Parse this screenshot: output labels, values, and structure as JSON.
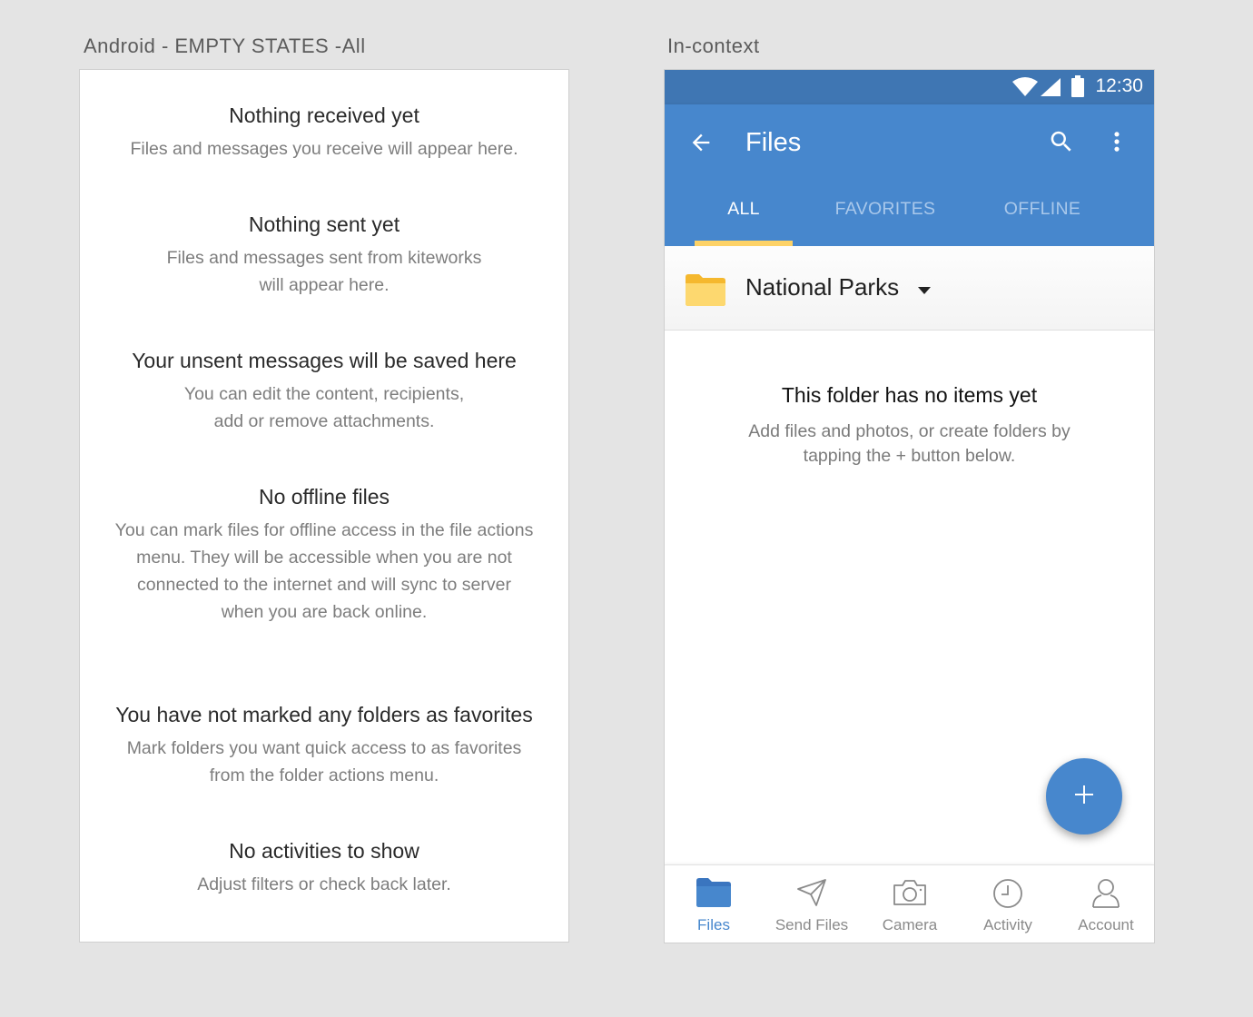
{
  "artboards": {
    "left_title": "Android - EMPTY STATES -All",
    "right_title": "In-context"
  },
  "empty_states": [
    {
      "title": "Nothing received yet",
      "lines": [
        "Files and messages you receive will appear here."
      ]
    },
    {
      "title": "Nothing sent yet",
      "lines": [
        "Files and messages sent from kiteworks",
        "will appear here."
      ]
    },
    {
      "title": "Your unsent messages will be saved here",
      "lines": [
        "You can edit the content, recipients,",
        "add or remove attachments."
      ]
    },
    {
      "title": "No offline files",
      "lines": [
        "You can mark files for offline access in the file actions",
        "menu. They will be accessible when you are not",
        "connected to the internet and will sync to server",
        "when you are back online."
      ]
    },
    {
      "title": "You have not marked any folders as favorites",
      "lines": [
        "Mark folders you want quick access to as favorites",
        "from the folder actions menu."
      ]
    },
    {
      "title": "No activities to show",
      "lines": [
        "Adjust filters or check back later."
      ]
    }
  ],
  "phone": {
    "status_bar": {
      "time": "12:30",
      "icons": [
        "wifi-icon",
        "signal-icon",
        "battery-icon"
      ]
    },
    "toolbar": {
      "title": "Files",
      "back_icon": "arrow-left-icon",
      "search_icon": "search-icon",
      "more_icon": "more-vert-icon"
    },
    "tabs": [
      {
        "label": "ALL",
        "active": true
      },
      {
        "label": "FAVORITES",
        "active": false
      },
      {
        "label": "OFFLINE",
        "active": false
      }
    ],
    "folder": {
      "name": "National Parks",
      "icon": "folder-icon",
      "dropdown_icon": "caret-down-icon"
    },
    "empty": {
      "title": "This folder has no items yet",
      "line1": "Add files and photos, or create folders by",
      "line2": "tapping the + button below."
    },
    "fab": {
      "icon": "plus-icon"
    },
    "bottom_nav": [
      {
        "label": "Files",
        "icon": "folder-icon",
        "active": true
      },
      {
        "label": "Send Files",
        "icon": "paper-plane-icon",
        "active": false
      },
      {
        "label": "Camera",
        "icon": "camera-icon",
        "active": false
      },
      {
        "label": "Activity",
        "icon": "clock-icon",
        "active": false
      },
      {
        "label": "Account",
        "icon": "person-icon",
        "active": false
      }
    ]
  },
  "colors": {
    "primary": "#4787cd",
    "status_bar": "#3f76b3",
    "tab_indicator": "#fdd267",
    "folder_yellow": "#fdd267",
    "background": "#e4e4e4"
  }
}
